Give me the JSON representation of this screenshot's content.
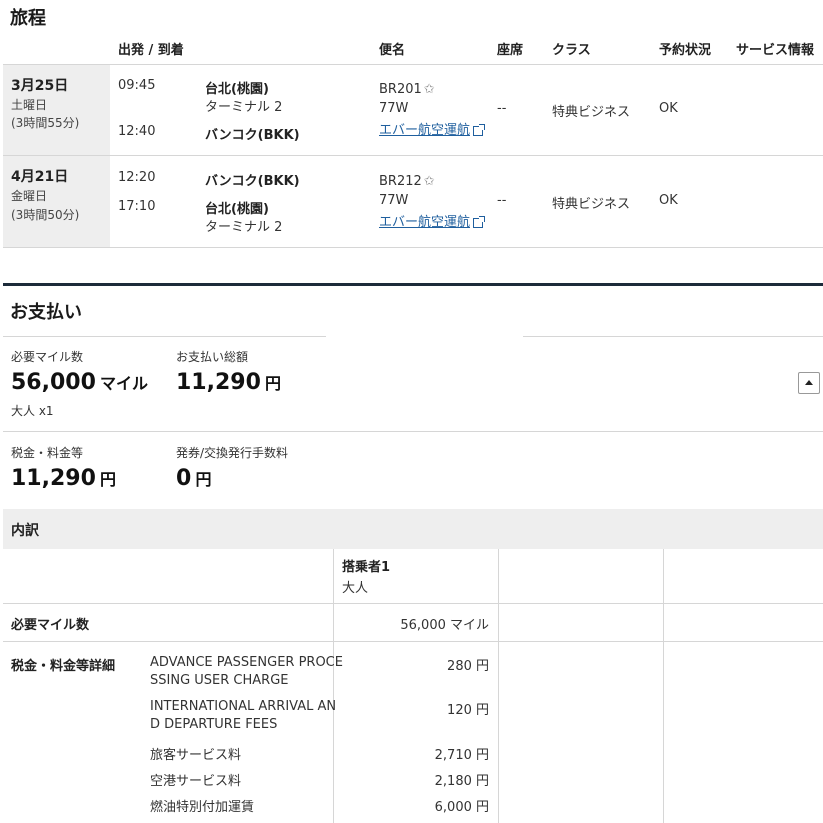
{
  "itinerary": {
    "title": "旅程",
    "headers": {
      "depart_arrive": "出発 / 到着",
      "flight": "便名",
      "seat": "座席",
      "class": "クラス",
      "status": "予約状況",
      "service": "サービス情報"
    },
    "segments": [
      {
        "date": "3月25日",
        "weekday": "土曜日",
        "duration": "(3時間55分)",
        "dep_time": "09:45",
        "dep_city": "台北(桃園)",
        "dep_terminal": "ターミナル 2",
        "arr_time": "12:40",
        "arr_city": "バンコク(BKK)",
        "arr_terminal": "",
        "flight_no": "BR201",
        "aircraft": "77W",
        "operator": "エバー航空運航",
        "seat": "--",
        "class": "特典ビジネス",
        "status": "OK"
      },
      {
        "date": "4月21日",
        "weekday": "金曜日",
        "duration": "(3時間50分)",
        "dep_time": "12:20",
        "dep_city": "バンコク(BKK)",
        "dep_terminal": "",
        "arr_time": "17:10",
        "arr_city": "台北(桃園)",
        "arr_terminal": "ターミナル 2",
        "flight_no": "BR212",
        "aircraft": "77W",
        "operator": "エバー航空運航",
        "seat": "--",
        "class": "特典ビジネス",
        "status": "OK"
      }
    ]
  },
  "payment": {
    "title": "お支払い",
    "miles_label": "必要マイル数",
    "miles_value": "56,000",
    "miles_unit": "マイル",
    "passengers": "大人 x1",
    "total_label": "お支払い総額",
    "total_value": "11,290",
    "total_unit": "円",
    "tax_label": "税金・料金等",
    "tax_value": "11,290",
    "tax_unit": "円",
    "fee_label": "発券/交換発行手数料",
    "fee_value": "0",
    "fee_unit": "円"
  },
  "breakdown": {
    "title": "内訳",
    "passenger_header": "搭乗者1",
    "passenger_type": "大人",
    "miles_row_label": "必要マイル数",
    "miles_row_value": "56,000 マイル",
    "tax_detail_label": "税金・料金等詳細",
    "items": [
      {
        "name_line1": "ADVANCE PASSENGER PROCE",
        "name_line2": "SSING USER CHARGE",
        "amount": "280 円"
      },
      {
        "name_line1": "INTERNATIONAL ARRIVAL AN",
        "name_line2": "D DEPARTURE FEES",
        "amount": "120 円"
      },
      {
        "name_line1": "旅客サービス料",
        "name_line2": "",
        "amount": "2,710 円"
      },
      {
        "name_line1": "空港サービス料",
        "name_line2": "",
        "amount": "2,180 円"
      },
      {
        "name_line1": "燃油特別付加運賃",
        "name_line2": "",
        "amount": "6,000 円"
      }
    ]
  },
  "icons": {
    "star": "star-icon",
    "external": "external-link-icon",
    "collapse": "collapse-up-icon"
  }
}
